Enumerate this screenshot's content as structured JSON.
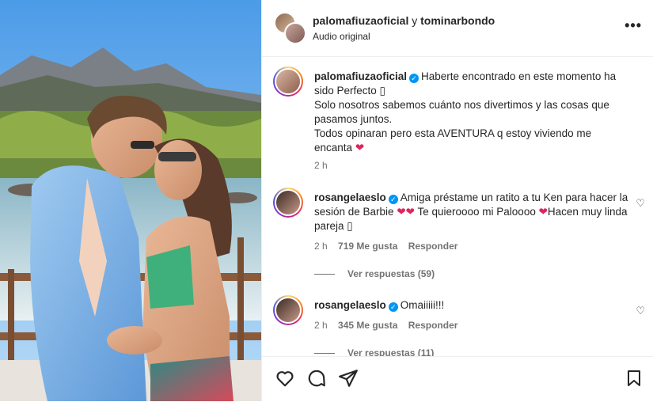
{
  "header": {
    "user1": "palomafiuzaoficial",
    "joiner": " y ",
    "user2": "tominarbondo",
    "subtitle": "Audio original",
    "more": "•••"
  },
  "caption": {
    "username": "palomafiuzaoficial",
    "text_line1": "Haberte encontrado en este momento ha sido Perfecto ▯",
    "text_line2": "Solo nosotros sabemos cuánto nos divertimos y las cosas que pasamos juntos.",
    "text_line3": "Todos opinaran pero esta AVENTURA q estoy viviendo me encanta",
    "time": "2 h"
  },
  "comments": [
    {
      "username": "rosangelaeslo",
      "text_a": "Amiga préstame un ratito a tu Ken para hacer la sesión de Barbie",
      "text_b": "Te quieroooo mi Paloooo",
      "text_c": "Hacen muy linda pareja ▯",
      "time": "2 h",
      "likes": "719 Me gusta",
      "reply": "Responder",
      "view_replies": "Ver respuestas (59)"
    },
    {
      "username": "rosangelaeslo",
      "text_a": "Omaiiiii!!!",
      "time": "2 h",
      "likes": "345 Me gusta",
      "reply": "Responder",
      "view_replies": "Ver respuestas (11)"
    }
  ],
  "icons": {
    "heart": "heart-icon",
    "comment": "comment-icon",
    "share": "share-icon",
    "save": "bookmark-icon"
  },
  "colors": {
    "verified": "#0095f6",
    "heart": "#e0245e",
    "muted": "#737373"
  }
}
